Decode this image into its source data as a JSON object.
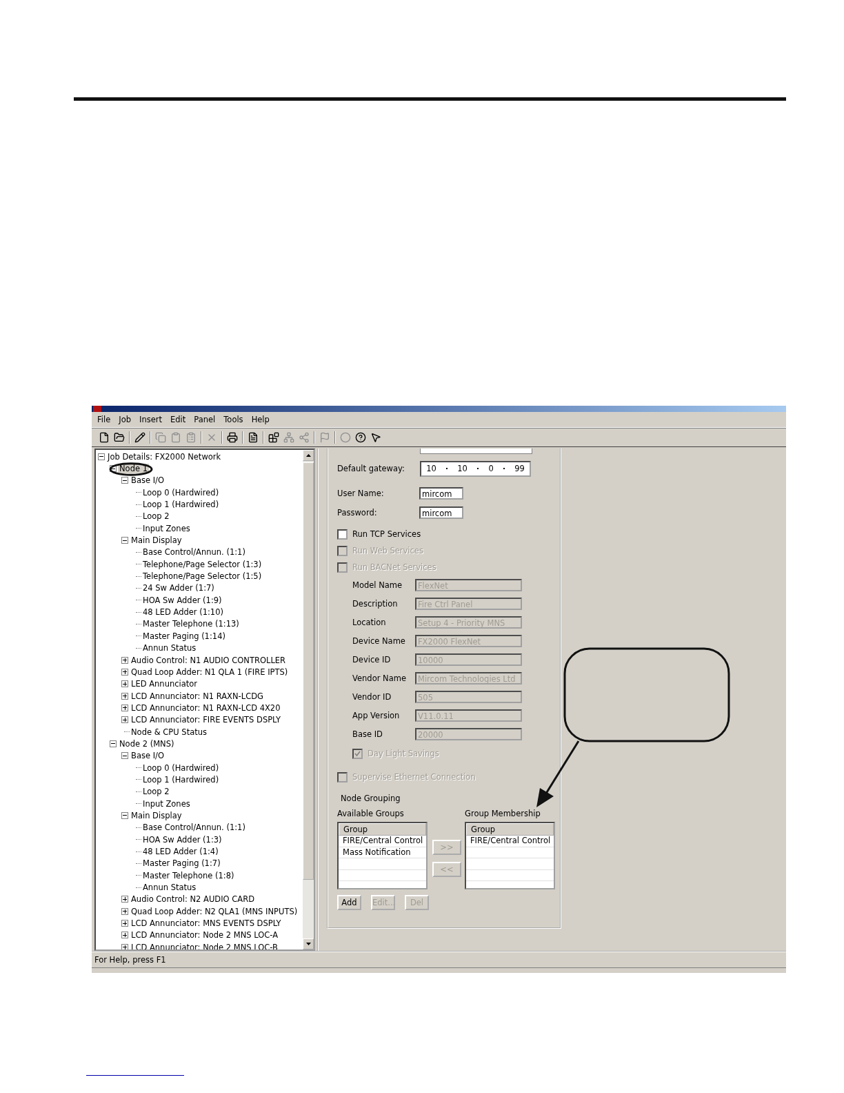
{
  "menu": [
    "File",
    "Job",
    "Insert",
    "Edit",
    "Panel",
    "Tools",
    "Help"
  ],
  "tree": [
    {
      "label": "Job Details: FX2000 Network",
      "expanded": true,
      "selected": false,
      "children": [
        {
          "label": "Node 1",
          "expanded": true,
          "selected": true,
          "children": [
            {
              "label": "Base I/O",
              "expanded": true,
              "selected": false,
              "children": [
                {
                  "label": "Loop 0  (Hardwired)",
                  "selected": false
                },
                {
                  "label": "Loop 1  (Hardwired)",
                  "selected": false
                },
                {
                  "label": "Loop 2",
                  "selected": false
                },
                {
                  "label": "Input Zones",
                  "selected": false
                }
              ]
            },
            {
              "label": "Main Display",
              "expanded": true,
              "selected": false,
              "children": [
                {
                  "label": "Base Control/Annun. (1:1)",
                  "selected": false
                },
                {
                  "label": "Telephone/Page Selector (1:3)",
                  "selected": false
                },
                {
                  "label": "Telephone/Page Selector (1:5)",
                  "selected": false
                },
                {
                  "label": "24 Sw Adder (1:7)",
                  "selected": false
                },
                {
                  "label": "HOA Sw Adder (1:9)",
                  "selected": false
                },
                {
                  "label": "48 LED Adder (1:10)",
                  "selected": false
                },
                {
                  "label": "Master Telephone (1:13)",
                  "selected": false
                },
                {
                  "label": "Master Paging (1:14)",
                  "selected": false
                },
                {
                  "label": "Annun Status",
                  "selected": false
                }
              ]
            },
            {
              "label": "Audio Control: N1 AUDIO CONTROLLER",
              "expanded": false,
              "selected": false
            },
            {
              "label": "Quad Loop Adder: N1 QLA 1 (FIRE IPTS)",
              "expanded": false,
              "selected": false
            },
            {
              "label": "LED Annunciator",
              "expanded": false,
              "selected": false
            },
            {
              "label": "LCD Annunciator: N1 RAXN-LCDG",
              "expanded": false,
              "selected": false
            },
            {
              "label": "LCD Annunciator: N1 RAXN-LCD 4X20",
              "expanded": false,
              "selected": false
            },
            {
              "label": "LCD Annunciator: FIRE EVENTS DSPLY",
              "expanded": false,
              "selected": false
            },
            {
              "label": "Node & CPU Status",
              "selected": false
            }
          ]
        },
        {
          "label": "Node 2 (MNS)",
          "expanded": true,
          "selected": false,
          "children": [
            {
              "label": "Base I/O",
              "expanded": true,
              "selected": false,
              "children": [
                {
                  "label": "Loop 0  (Hardwired)",
                  "selected": false
                },
                {
                  "label": "Loop 1  (Hardwired)",
                  "selected": false
                },
                {
                  "label": "Loop 2",
                  "selected": false
                },
                {
                  "label": "Input Zones",
                  "selected": false
                }
              ]
            },
            {
              "label": "Main Display",
              "expanded": true,
              "selected": false,
              "children": [
                {
                  "label": "Base Control/Annun. (1:1)",
                  "selected": false
                },
                {
                  "label": "HOA Sw Adder (1:3)",
                  "selected": false
                },
                {
                  "label": "48 LED Adder (1:4)",
                  "selected": false
                },
                {
                  "label": "Master Paging (1:7)",
                  "selected": false
                },
                {
                  "label": "Master Telephone (1:8)",
                  "selected": false
                },
                {
                  "label": "Annun Status",
                  "selected": false
                }
              ]
            },
            {
              "label": "Audio Control: N2 AUDIO CARD",
              "expanded": false,
              "selected": false
            },
            {
              "label": "Quad Loop Adder: N2 QLA1 (MNS INPUTS)",
              "expanded": false,
              "selected": false
            },
            {
              "label": "LCD Annunciator: MNS EVENTS DSPLY",
              "expanded": false,
              "selected": false
            },
            {
              "label": "LCD Annunciator: Node 2 MNS LOC-A",
              "expanded": false,
              "selected": false
            },
            {
              "label": "LCD Annunciator: Node 2 MNS LOC-B",
              "expanded": false,
              "selected": false
            }
          ]
        }
      ]
    }
  ],
  "gateway": {
    "label": "Default gateway:",
    "octets": [
      "10",
      "10",
      "0",
      "99"
    ]
  },
  "credentials": [
    {
      "label": "User Name:",
      "value": "mircom"
    },
    {
      "label": "Password:",
      "value": "mircom"
    }
  ],
  "services": [
    {
      "label": "Run TCP Services",
      "checked": false,
      "disabled": false
    },
    {
      "label": "Run Web Services",
      "checked": false,
      "disabled": true
    },
    {
      "label": "Run BACNet Services",
      "checked": false,
      "disabled": true
    }
  ],
  "device_info": [
    {
      "label": "Model Name",
      "value": "FlexNet"
    },
    {
      "label": "Description",
      "value": "Fire Ctrl Panel"
    },
    {
      "label": "Location",
      "value": "Setup 4 - Priority MNS"
    },
    {
      "label": "Device Name",
      "value": "FX2000 FlexNet"
    },
    {
      "label": "Device ID",
      "value": "10000"
    },
    {
      "label": "Vendor Name",
      "value": "Mircom Technologies Ltd"
    },
    {
      "label": "Vendor ID",
      "value": "505"
    },
    {
      "label": "App Version",
      "value": "V11.0.11"
    },
    {
      "label": "Base ID",
      "value": "20000"
    }
  ],
  "daylight": {
    "label": "Day Light Savings",
    "checked": true,
    "disabled": true
  },
  "supervise": {
    "label": "Supervise Ethernet Connection",
    "checked": false,
    "disabled": true
  },
  "node_grouping": {
    "title": "Node Grouping",
    "available": {
      "title": "Available Groups",
      "header": "Group",
      "rows": [
        "FIRE/Central Control",
        "Mass Notification"
      ]
    },
    "membership": {
      "title": "Group Membership",
      "header": "Group",
      "rows": [
        "FIRE/Central Control"
      ]
    },
    "move_buttons": [
      {
        "label": ">>",
        "disabled": true
      },
      {
        "label": "<<",
        "disabled": true
      }
    ],
    "buttons": [
      {
        "label": "Add",
        "disabled": false
      },
      {
        "label": "Edit...",
        "disabled": true
      },
      {
        "label": "Del",
        "disabled": true
      }
    ]
  },
  "status_bar": "For Help, press F1"
}
